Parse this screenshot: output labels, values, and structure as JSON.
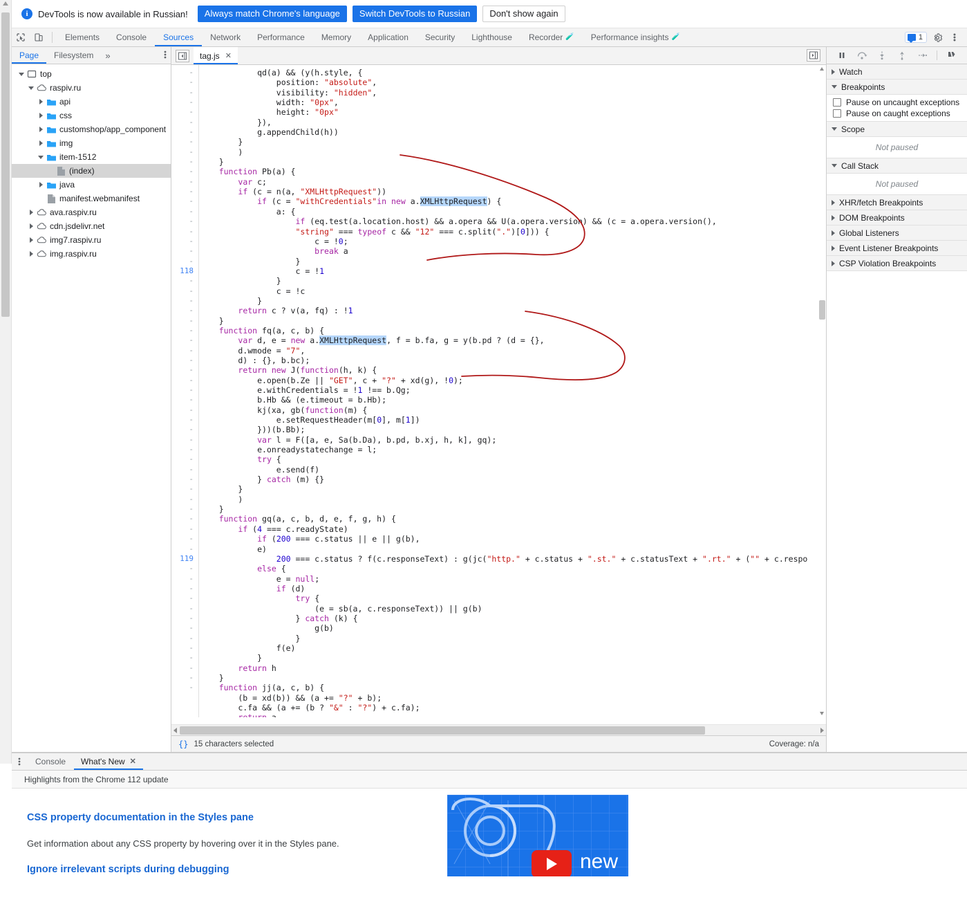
{
  "banner": {
    "icon": "info-icon",
    "message": "DevTools is now available in Russian!",
    "btn_always": "Always match Chrome's language",
    "btn_switch": "Switch DevTools to Russian",
    "btn_dismiss": "Don't show again",
    "accent_color": "#1a73e8"
  },
  "tabbar": {
    "inspect_icon": "inspect-cursor-icon",
    "device_icon": "device-toolbar-icon",
    "tabs": [
      {
        "label": "Elements",
        "active": false
      },
      {
        "label": "Console",
        "active": false
      },
      {
        "label": "Sources",
        "active": true
      },
      {
        "label": "Network",
        "active": false
      },
      {
        "label": "Performance",
        "active": false
      },
      {
        "label": "Memory",
        "active": false
      },
      {
        "label": "Application",
        "active": false
      },
      {
        "label": "Security",
        "active": false
      },
      {
        "label": "Lighthouse",
        "active": false
      },
      {
        "label": "Recorder",
        "active": false,
        "experimental": true
      },
      {
        "label": "Performance insights",
        "active": false,
        "experimental": true
      }
    ],
    "issues_count": "1",
    "settings_icon": "gear-icon",
    "more_icon": "kebab-menu-icon"
  },
  "navigator": {
    "tabs": [
      {
        "label": "Page",
        "active": true
      },
      {
        "label": "Filesystem",
        "active": false
      }
    ],
    "more_label": "»",
    "menu_icon": "kebab-menu-icon",
    "tree": [
      {
        "label": "top",
        "indent": 0,
        "twisty": "open",
        "icon": "frame-icon",
        "selected": false
      },
      {
        "label": "raspiv.ru",
        "indent": 1,
        "twisty": "open",
        "icon": "cloud-icon",
        "selected": false
      },
      {
        "label": "api",
        "indent": 2,
        "twisty": "closed",
        "icon": "folder-icon",
        "selected": false
      },
      {
        "label": "css",
        "indent": 2,
        "twisty": "closed",
        "icon": "folder-icon",
        "selected": false
      },
      {
        "label": "customshop/app_component",
        "indent": 2,
        "twisty": "closed",
        "icon": "folder-icon",
        "selected": false
      },
      {
        "label": "img",
        "indent": 2,
        "twisty": "closed",
        "icon": "folder-icon",
        "selected": false
      },
      {
        "label": "item-1512",
        "indent": 2,
        "twisty": "open",
        "icon": "folder-icon",
        "selected": false
      },
      {
        "label": "(index)",
        "indent": 3,
        "twisty": "none",
        "icon": "document-icon",
        "selected": true
      },
      {
        "label": "java",
        "indent": 2,
        "twisty": "closed",
        "icon": "folder-icon",
        "selected": false
      },
      {
        "label": "manifest.webmanifest",
        "indent": 2,
        "twisty": "none",
        "icon": "document-icon",
        "selected": false
      },
      {
        "label": "ava.raspiv.ru",
        "indent": 1,
        "twisty": "closed",
        "icon": "cloud-icon",
        "selected": false
      },
      {
        "label": "cdn.jsdelivr.net",
        "indent": 1,
        "twisty": "closed",
        "icon": "cloud-icon",
        "selected": false
      },
      {
        "label": "img7.raspiv.ru",
        "indent": 1,
        "twisty": "closed",
        "icon": "cloud-icon",
        "selected": false
      },
      {
        "label": "img.raspiv.ru",
        "indent": 1,
        "twisty": "closed",
        "icon": "cloud-icon",
        "selected": false
      }
    ]
  },
  "editor": {
    "collapse_icon": "collapse-sidebar-icon",
    "expand_icon": "expand-sidebar-icon",
    "file_tab": "tag.js",
    "close_icon": "close-icon",
    "line_numbers": [
      "-",
      "-",
      "-",
      "-",
      "-",
      "-",
      "-",
      "-",
      "-",
      "-",
      "-",
      "-",
      "-",
      "-",
      "-",
      "-",
      "-",
      "-",
      "-",
      "-",
      "118",
      "-",
      "-",
      "-",
      "-",
      "-",
      "-",
      "-",
      "-",
      "-",
      "-",
      "-",
      "-",
      "-",
      "-",
      "-",
      "-",
      "-",
      "-",
      "-",
      "-",
      "-",
      "-",
      "-",
      "-",
      "-",
      "-",
      "-",
      "-",
      "119",
      "-",
      "-",
      "-",
      "-",
      "-",
      "-",
      "-",
      "-",
      "-",
      "-",
      "-",
      "-",
      "-"
    ],
    "lines": [
      "            qd(a) && (y(h.style, {",
      "                position: \"absolute\",",
      "                visibility: \"hidden\",",
      "                width: \"0px\",",
      "                height: \"0px\"",
      "            }),",
      "            g.appendChild(h))",
      "        }",
      "        )",
      "    }",
      "    function Pb(a) {",
      "        var c;",
      "        if (c = n(a, \"XMLHttpRequest\"))",
      "            if (c = \"withCredentials\"in new a.XMLHttpRequest) {",
      "                a: {",
      "                    if (eq.test(a.location.host) && a.opera && U(a.opera.version) && (c = a.opera.version(),",
      "                    \"string\" === typeof c && \"12\" === c.split(\".\")[0])) {",
      "                        c = !0;",
      "                        break a",
      "                    }",
      "                    c = !1",
      "                }",
      "                c = !c",
      "            }",
      "        return c ? v(a, fq) : !1",
      "    }",
      "    function fq(a, c, b) {",
      "        var d, e = new a.XMLHttpRequest, f = b.fa, g = y(b.pd ? (d = {},",
      "        d.wmode = \"7\",",
      "        d) : {}, b.bc);",
      "        return new J(function(h, k) {",
      "            e.open(b.Ze || \"GET\", c + \"?\" + xd(g), !0);",
      "            e.withCredentials = !1 !== b.Qg;",
      "            b.Hb && (e.timeout = b.Hb);",
      "            kj(xa, gb(function(m) {",
      "                e.setRequestHeader(m[0], m[1])",
      "            }))(b.Bb);",
      "            var l = F([a, e, Sa(b.Da), b.pd, b.xj, h, k], gq);",
      "            e.onreadystatechange = l;",
      "            try {",
      "                e.send(f)",
      "            } catch (m) {}",
      "        }",
      "        )",
      "    }",
      "    function gq(a, c, b, d, e, f, g, h) {",
      "        if (4 === c.readyState)",
      "            if (200 === c.status || e || g(b),",
      "            e)",
      "                200 === c.status ? f(c.responseText) : g(jc(\"http.\" + c.status + \".st.\" + c.statusText + \".rt.\" + (\"\" + c.respo",
      "            else {",
      "                e = null;",
      "                if (d)",
      "                    try {",
      "                        (e = sb(a, c.responseText)) || g(b)",
      "                    } catch (k) {",
      "                        g(b)",
      "                    }",
      "                f(e)",
      "            }",
      "        return h",
      "    }",
      "    function jj(a, c, b) {",
      "        (b = xd(b)) && (a += \"?\" + b);",
      "        c.fa && (a += (b ? \"&\" : \"?\") + c.fa);",
      "        return a",
      "    }"
    ],
    "status_format_icon": "{}",
    "status_text": "15 characters selected",
    "coverage_text": "Coverage: n/a"
  },
  "debugger": {
    "toolbar": [
      {
        "icon": "pause-icon",
        "name": "pause-script-execution"
      },
      {
        "icon": "step-over-icon",
        "name": "step-over-next-function-call"
      },
      {
        "icon": "step-into-icon",
        "name": "step-into-next-function-call"
      },
      {
        "icon": "step-out-icon",
        "name": "step-out-of-current-function"
      },
      {
        "icon": "step-icon",
        "name": "step"
      },
      {
        "icon": "deactivate-breakpoints-icon",
        "name": "deactivate-breakpoints"
      }
    ],
    "sections": [
      {
        "title": "Watch",
        "open": false,
        "body": null
      },
      {
        "title": "Breakpoints",
        "open": true,
        "body": "checkboxes"
      },
      {
        "title": "Scope",
        "open": true,
        "body": "Not paused"
      },
      {
        "title": "Call Stack",
        "open": true,
        "body": "Not paused"
      },
      {
        "title": "XHR/fetch Breakpoints",
        "open": false,
        "body": null
      },
      {
        "title": "DOM Breakpoints",
        "open": false,
        "body": null
      },
      {
        "title": "Global Listeners",
        "open": false,
        "body": null
      },
      {
        "title": "Event Listener Breakpoints",
        "open": false,
        "body": null
      },
      {
        "title": "CSP Violation Breakpoints",
        "open": false,
        "body": null
      }
    ],
    "checkboxes": [
      {
        "label": "Pause on uncaught exceptions",
        "checked": false
      },
      {
        "label": "Pause on caught exceptions",
        "checked": false
      }
    ]
  },
  "drawer": {
    "menu_icon": "kebab-menu-icon",
    "tabs": [
      {
        "label": "Console",
        "active": false,
        "closable": false
      },
      {
        "label": "What's New",
        "active": true,
        "closable": true
      }
    ],
    "close_icon": "close-icon",
    "subtitle": "Highlights from the Chrome 112 update",
    "items": [
      {
        "heading": "CSS property documentation in the Styles pane",
        "text": "Get information about any CSS property by hovering over it in the Styles pane."
      },
      {
        "heading": "Ignore irrelevant scripts during debugging",
        "text": ""
      }
    ],
    "thumbnail": {
      "play_icon": "youtube-play-icon",
      "caption": "new",
      "bg_color": "#1a73e8"
    }
  },
  "annotation": {
    "color": "#b01818",
    "shapes": [
      "bracket-curve-upper",
      "bracket-curve-lower"
    ]
  }
}
